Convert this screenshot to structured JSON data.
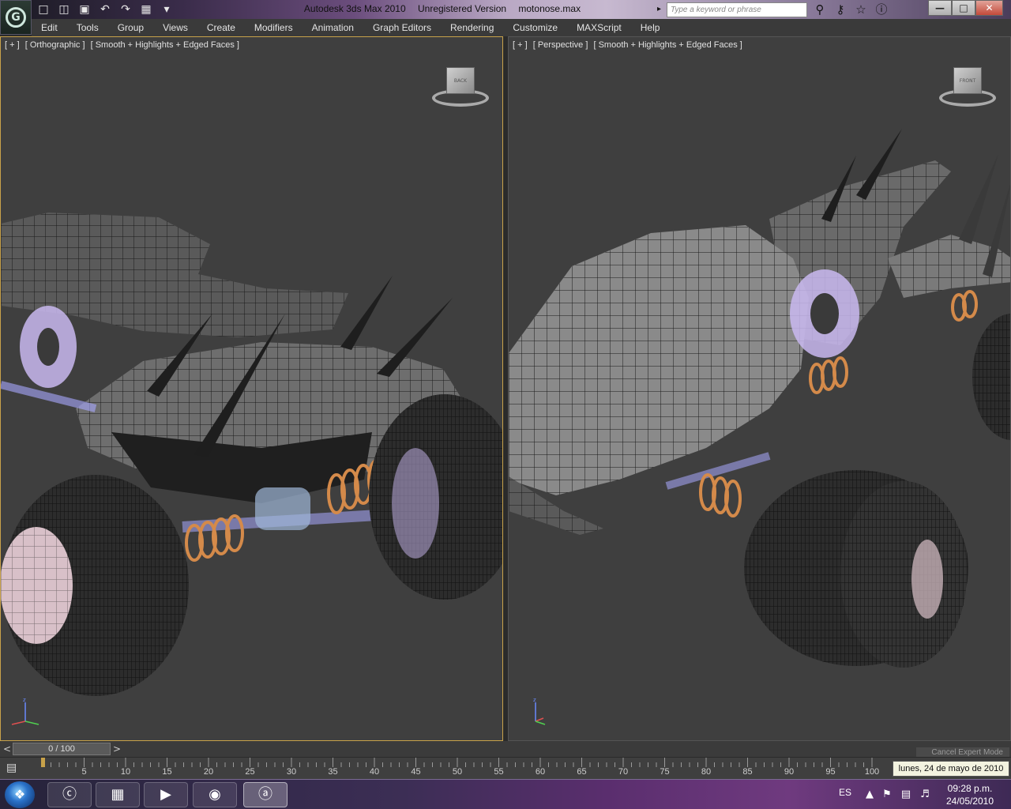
{
  "window": {
    "app_title": "Autodesk 3ds Max  2010",
    "version_note": "Unregistered Version",
    "file_name": "motonose.max",
    "search_placeholder": "Type a keyword or phrase"
  },
  "menu": [
    "Edit",
    "Tools",
    "Group",
    "Views",
    "Create",
    "Modifiers",
    "Animation",
    "Graph Editors",
    "Rendering",
    "Customize",
    "MAXScript",
    "Help"
  ],
  "viewports": {
    "left": {
      "plus": "[ + ]",
      "view": "[ Orthographic ]",
      "shading": "[ Smooth + Highlights + Edged Faces ]",
      "cube_face": "BACK"
    },
    "right": {
      "plus": "[ + ]",
      "view": "[ Perspective ]",
      "shading": "[ Smooth + Highlights + Edged Faces ]",
      "cube_face": "FRONT"
    }
  },
  "timeslider": {
    "value": "0 / 100",
    "prev": "<",
    "next": ">",
    "expert_mode": "Cancel Expert Mode"
  },
  "trackbar": {
    "ticks": [
      "5",
      "10",
      "15",
      "20",
      "25",
      "30",
      "35",
      "40",
      "45",
      "50",
      "55",
      "60",
      "65",
      "70",
      "75",
      "80",
      "85",
      "90",
      "95",
      "100"
    ]
  },
  "tooltip": "lunes, 24 de mayo de 2010",
  "taskbar": {
    "language": "ES",
    "time": "09:28 p.m.",
    "date": "24/05/2010"
  },
  "colors": {
    "accent_border": "#c8a24a",
    "viewport_bg": "#3f3f3f",
    "menubar_bg": "#3a3a3a"
  }
}
